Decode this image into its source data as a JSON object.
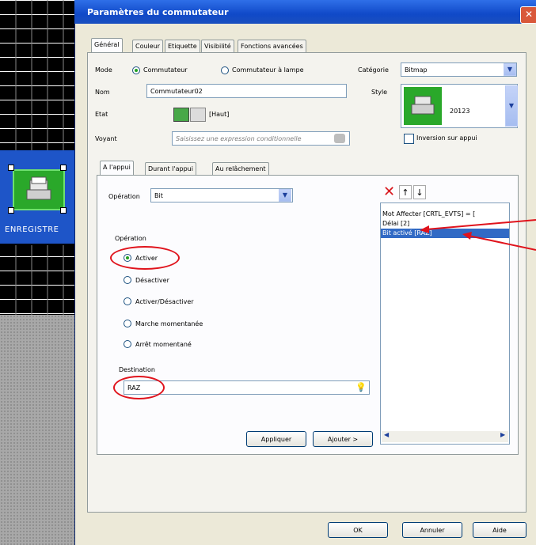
{
  "background": {
    "widget_label": "ENREGISTRE"
  },
  "dialog": {
    "title": "Paramètres du commutateur",
    "close_glyph": "✕",
    "tabs": [
      "Général",
      "Couleur",
      "Etiquette",
      "Visibilité",
      "Fonctions avancées"
    ],
    "mode": {
      "label": "Mode",
      "options": [
        "Commutateur",
        "Commutateur à lampe"
      ],
      "selected": "Commutateur"
    },
    "category": {
      "label": "Catégorie",
      "value": "Bitmap"
    },
    "name": {
      "label": "Nom",
      "value": "Commutateur02"
    },
    "style": {
      "label": "Style",
      "value": "20123"
    },
    "state": {
      "label": "Etat",
      "value": "[Haut]"
    },
    "indicator": {
      "label": "Voyant",
      "placeholder": "Saisissez une expression conditionnelle"
    },
    "invert_on_press": {
      "label": "Inversion sur appui",
      "checked": false
    },
    "subtabs": [
      "A l'appui",
      "Durant l'appui",
      "Au relâchement"
    ],
    "operation_type": {
      "label": "Opération",
      "value": "Bit"
    },
    "operation_group": {
      "label": "Opération",
      "options": [
        "Activer",
        "Désactiver",
        "Activer/Désactiver",
        "Marche momentanée",
        "Arrêt momentané"
      ],
      "selected": "Activer"
    },
    "destination": {
      "label": "Destination",
      "value": "RAZ"
    },
    "action_list": [
      "Mot Affecter [CRTL_EVTS] = [",
      "Délai [2]",
      "Bit activé [RAZ]"
    ],
    "action_list_selected": 2,
    "apply_button": "Appliquer",
    "add_button": "Ajouter >",
    "ok_button": "OK",
    "cancel_button": "Annuler",
    "help_button": "Aide"
  },
  "colors": {
    "titlebar": "#1049c8",
    "dialog_bg": "#ece9d8",
    "highlight": "#316ac5",
    "annotation_red": "#e0131c",
    "widget_green": "#2aa82a"
  }
}
